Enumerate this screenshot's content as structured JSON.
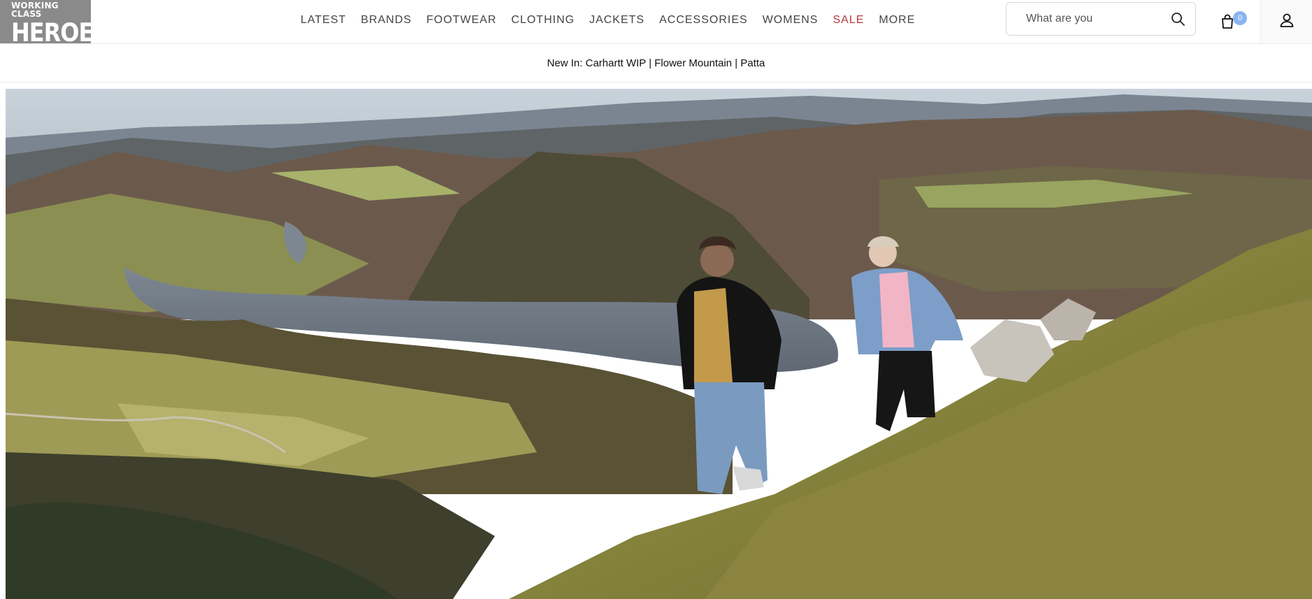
{
  "brand": {
    "line1": "WORKING CLASS",
    "line2": "HEROES"
  },
  "nav": [
    {
      "label": "LATEST",
      "key": "latest"
    },
    {
      "label": "BRANDS",
      "key": "brands"
    },
    {
      "label": "FOOTWEAR",
      "key": "footwear"
    },
    {
      "label": "CLOTHING",
      "key": "clothing"
    },
    {
      "label": "JACKETS",
      "key": "jackets"
    },
    {
      "label": "ACCESSORIES",
      "key": "accessories"
    },
    {
      "label": "WOMENS",
      "key": "womens"
    },
    {
      "label": "SALE",
      "key": "sale"
    },
    {
      "label": "MORE",
      "key": "more"
    }
  ],
  "search": {
    "placeholder": "What are you",
    "icon": "search-icon"
  },
  "cart": {
    "count": "0",
    "icon": "shopping-bag-icon"
  },
  "account": {
    "icon": "user-icon"
  },
  "announcement": {
    "text": "New In: Carhartt WIP | Flower Mountain | Patta"
  },
  "colors": {
    "sale": "#b23a3a",
    "badge": "#8ab4f0",
    "logo_bg": "#8a8a8a"
  }
}
